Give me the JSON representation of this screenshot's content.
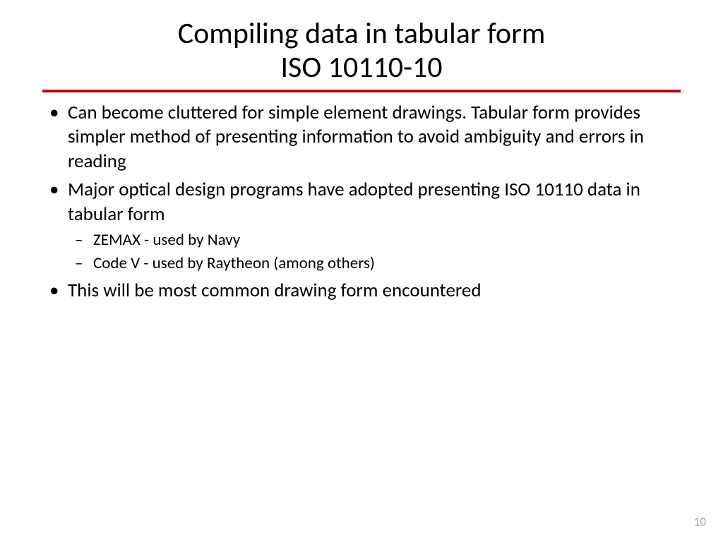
{
  "title_line_1": "Compiling data in tabular form",
  "title_line_2": "ISO 10110-10",
  "bullets": {
    "b1": "Can become cluttered for simple element drawings.  Tabular form provides simpler method of presenting information to avoid ambiguity and errors in reading",
    "b2": "Major optical design programs have adopted presenting ISO 10110 data in tabular form",
    "b2_sub1": "ZEMAX - used by Navy",
    "b2_sub2": "Code V - used by Raytheon (among others)",
    "b3": "This will be most common drawing form encountered"
  },
  "page_number": "10"
}
